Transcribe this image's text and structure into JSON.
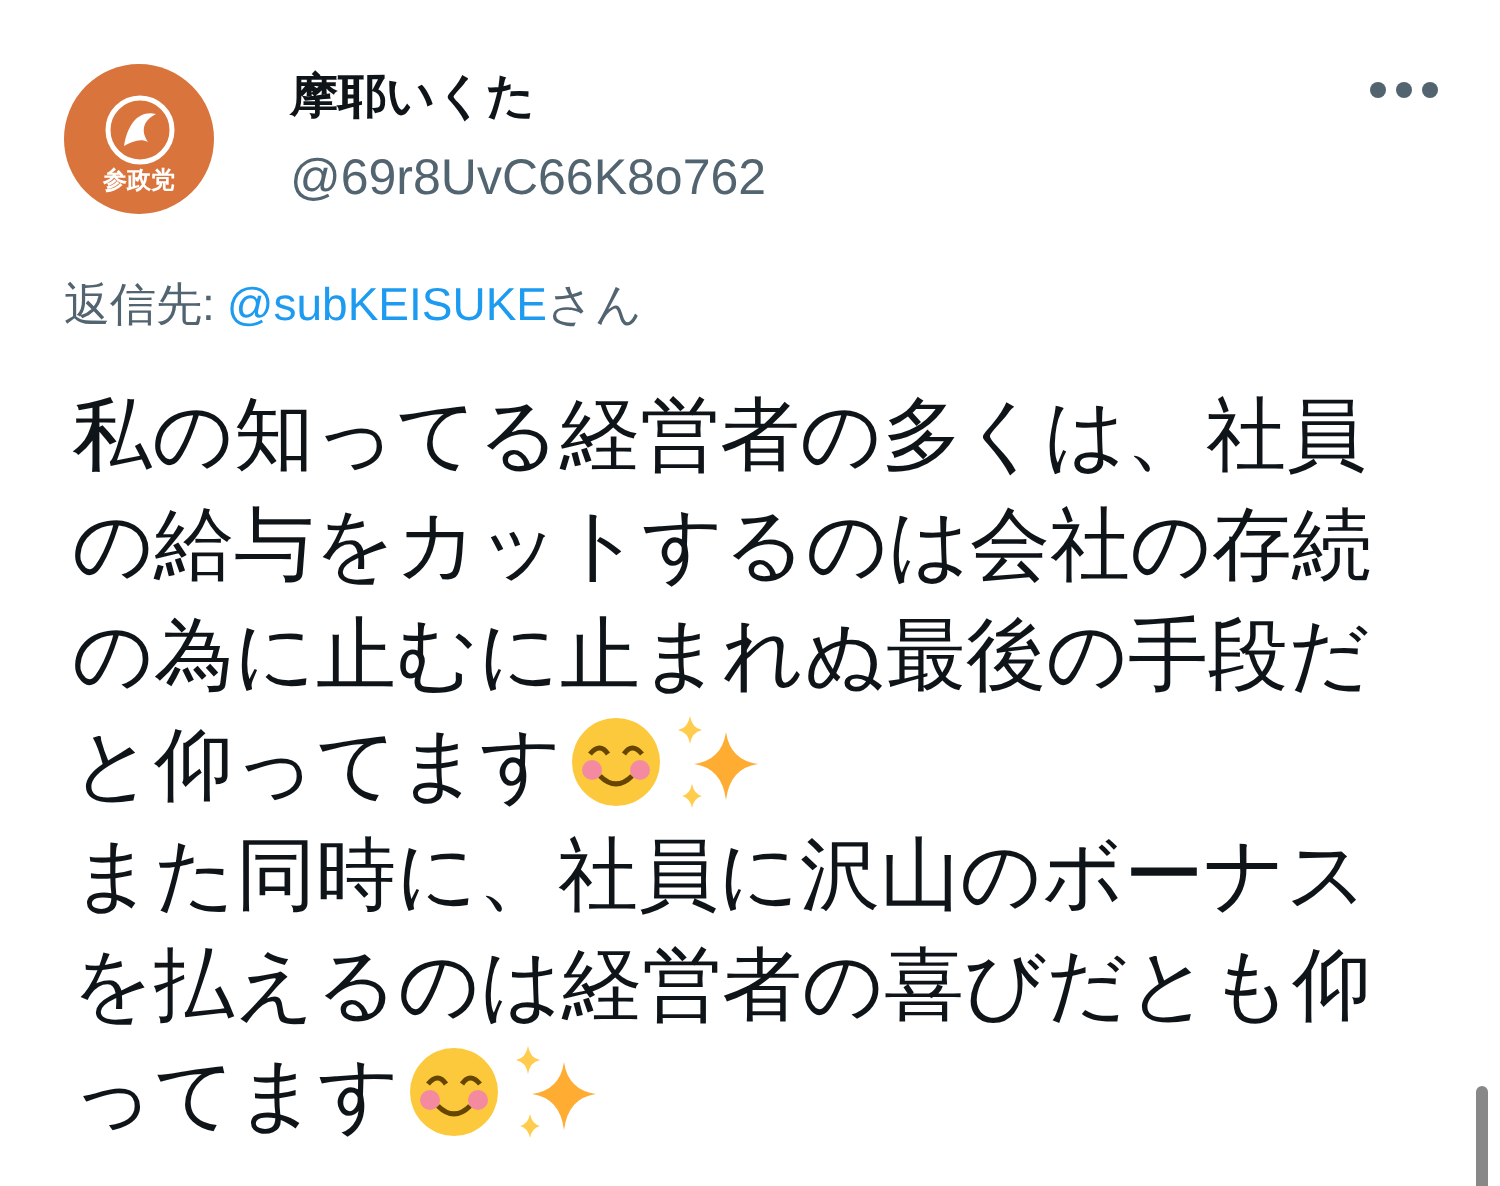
{
  "author": {
    "avatar_text": "参政党",
    "name": "摩耶いくた",
    "handle": "@69r8UvC66K8o762"
  },
  "reply_to": {
    "label": "返信先:",
    "mention": "@subKEISUKE",
    "suffix": "さん"
  },
  "body": [
    [
      {
        "kind": "text",
        "text": "私の知ってる経営者の多くは、社員"
      }
    ],
    [
      {
        "kind": "text",
        "text": "の給与をカットするのは会社の存続"
      }
    ],
    [
      {
        "kind": "text",
        "text": "の為に止むに止まれぬ最後の手段だ"
      }
    ],
    [
      {
        "kind": "text",
        "text": "と仰ってます"
      },
      {
        "kind": "smile"
      },
      {
        "kind": "sparkles"
      }
    ],
    [
      {
        "kind": "text",
        "text": "また同時に、社員に沢山のボーナス"
      }
    ],
    [
      {
        "kind": "text",
        "text": "を払えるのは経営者の喜びだとも仰"
      }
    ],
    [
      {
        "kind": "text",
        "text": "ってます"
      },
      {
        "kind": "smile"
      },
      {
        "kind": "sparkles"
      }
    ]
  ]
}
